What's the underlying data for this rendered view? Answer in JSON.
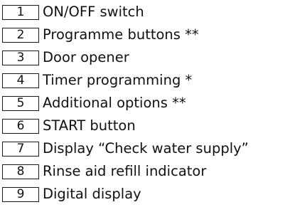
{
  "legend": {
    "items": [
      {
        "number": "1",
        "label": "ON/OFF switch"
      },
      {
        "number": "2",
        "label": "Programme buttons **"
      },
      {
        "number": "3",
        "label": "Door opener"
      },
      {
        "number": "4",
        "label": "Timer programming *"
      },
      {
        "number": "5",
        "label": "Additional options **"
      },
      {
        "number": "6",
        "label": "START button"
      },
      {
        "number": "7",
        "label": "Display “Check water supply”"
      },
      {
        "number": "8",
        "label": "Rinse aid refill indicator"
      },
      {
        "number": "9",
        "label": "Digital display"
      }
    ]
  }
}
